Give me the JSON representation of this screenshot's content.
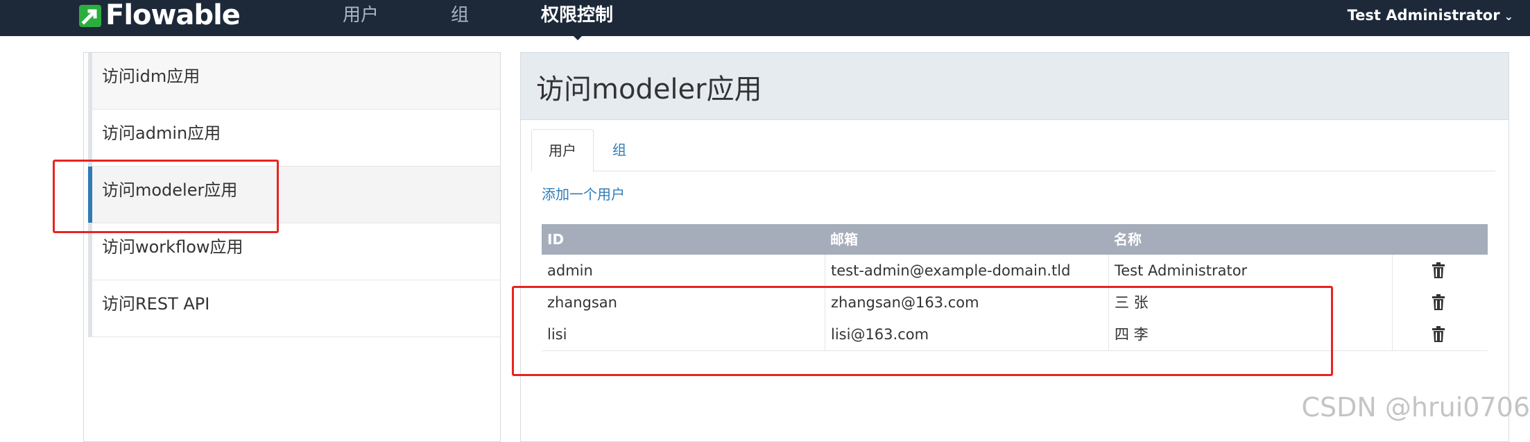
{
  "navbar": {
    "brand": "Flowable",
    "items": [
      {
        "label": "用户"
      },
      {
        "label": "组"
      },
      {
        "label": "权限控制"
      }
    ],
    "user": "Test Administrator"
  },
  "sidebar": {
    "items": [
      {
        "label": "访问idm应用"
      },
      {
        "label": "访问admin应用"
      },
      {
        "label": "访问modeler应用"
      },
      {
        "label": "访问workflow应用"
      },
      {
        "label": "访问REST API"
      }
    ],
    "active_index": 2
  },
  "main": {
    "title": "访问modeler应用",
    "tabs": [
      {
        "label": "用户"
      },
      {
        "label": "组"
      }
    ],
    "add_user_label": "添加一个用户",
    "table": {
      "headers": [
        "ID",
        "邮箱",
        "名称"
      ],
      "rows": [
        {
          "id": "admin",
          "email": "test-admin@example-domain.tld",
          "name": "Test Administrator"
        },
        {
          "id": "zhangsan",
          "email": "zhangsan@163.com",
          "name": "三 张"
        },
        {
          "id": "lisi",
          "email": "lisi@163.com",
          "name": "四 李"
        }
      ]
    }
  },
  "watermark": "CSDN @hrui0706",
  "colors": {
    "navbar": "#1d2939",
    "accent": "#2e7bb6",
    "table_header": "#a5adbb",
    "highlight": "#e8231f"
  }
}
